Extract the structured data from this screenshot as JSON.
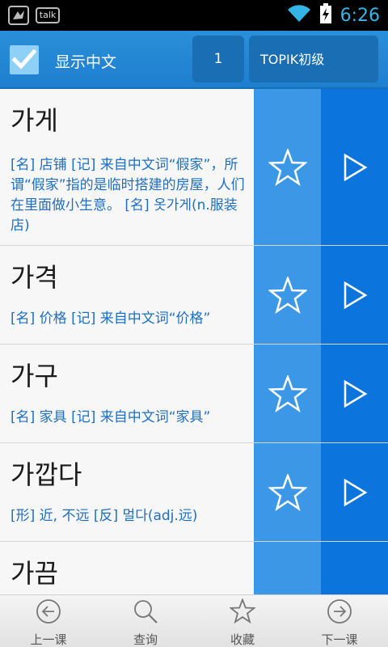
{
  "status_bar": {
    "talk_label": "talk",
    "time": "6:26"
  },
  "toolbar": {
    "show_chinese_label": "显示中文",
    "show_chinese_checked": true,
    "lesson_number": "1",
    "level_label": "TOPIK初级"
  },
  "words": [
    {
      "word": "가게",
      "definition": "[名] 店铺 [记] 来自中文词“假家”，所谓“假家”指的是临时搭建的房屋，人们在里面做小生意。 [名] 옷가게(n.服装店)"
    },
    {
      "word": "가격",
      "definition": "[名] 价格 [记] 来自中文词“价格”"
    },
    {
      "word": "가구",
      "definition": "[名] 家具 [记] 来自中文词“家具”"
    },
    {
      "word": "가깝다",
      "definition": "[形] 近, 不远 [反] 멀다(adj.远)"
    },
    {
      "word": "가끔",
      "definition": ""
    }
  ],
  "bottom_nav": {
    "prev_label": "上一课",
    "search_label": "查询",
    "favorite_label": "收藏",
    "next_label": "下一课"
  },
  "colors": {
    "toolbar_blue": "#1e7fcf",
    "star_column": "#3c98e6",
    "play_column": "#0b75dd",
    "definition_text": "#1e6fc2",
    "clock": "#33b5e5"
  },
  "icons": {
    "status_left": [
      "bird-notification-icon",
      "talk-icon"
    ],
    "status_right": [
      "wifi-icon",
      "battery-charging-icon"
    ],
    "row_actions": [
      "star-icon",
      "play-icon"
    ],
    "nav": [
      "arrow-left-circle-icon",
      "magnifier-icon",
      "star-icon",
      "arrow-right-circle-icon"
    ]
  }
}
